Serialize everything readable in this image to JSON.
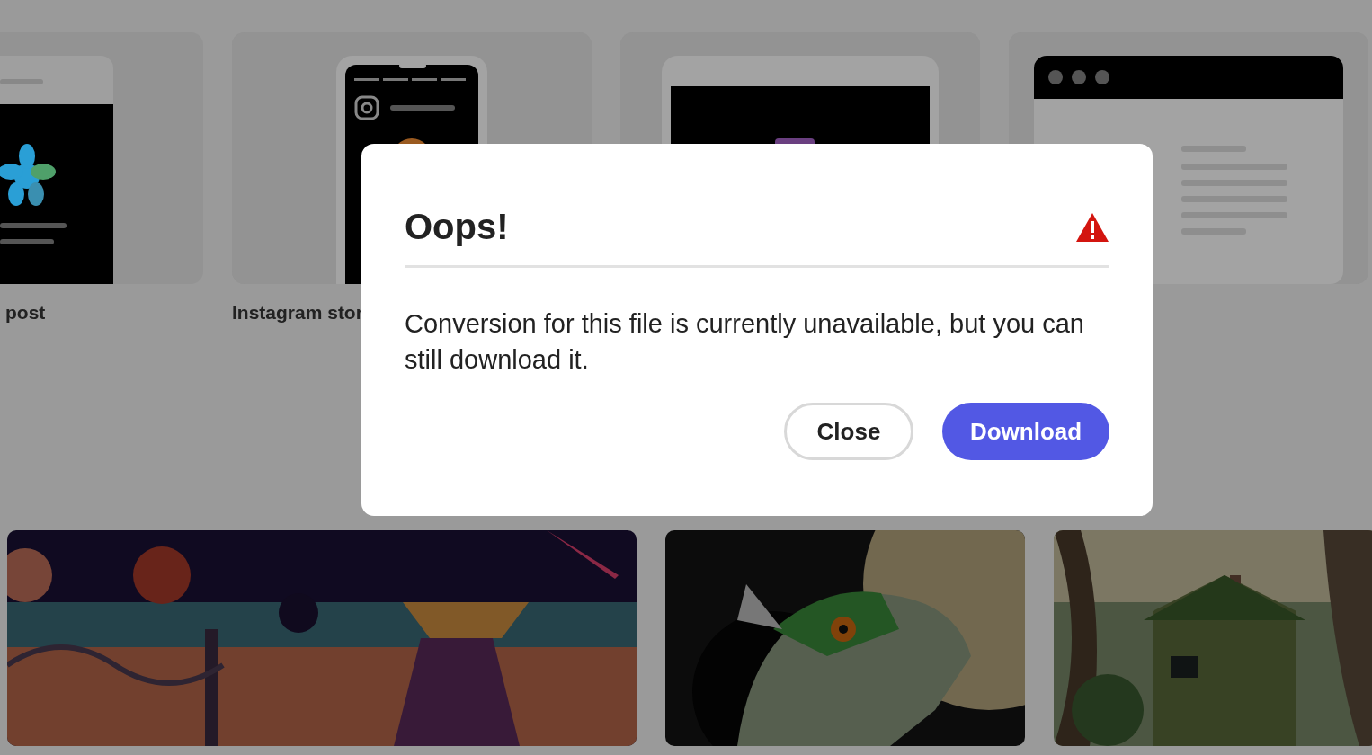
{
  "background": {
    "templates": [
      {
        "kind": "social",
        "label": "post"
      },
      {
        "kind": "phone",
        "label": "Instagram stor"
      },
      {
        "kind": "tablet"
      },
      {
        "kind": "browser"
      }
    ]
  },
  "dialog": {
    "title": "Oops!",
    "message": "Conversion for this file is currently unavailable, but you can still download it.",
    "buttons": [
      {
        "kind": "secondary",
        "label": "Close"
      },
      {
        "kind": "primary",
        "label": "Download"
      }
    ]
  }
}
